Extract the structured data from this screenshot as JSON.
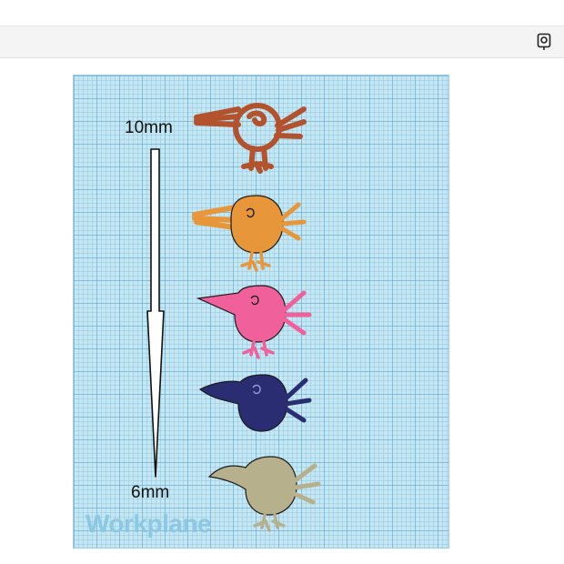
{
  "workplane": {
    "label": "Workplane"
  },
  "measure": {
    "top_label": "10mm",
    "bottom_label": "6mm"
  },
  "toolbar": {
    "icon": "snap-marker-icon"
  },
  "birds": [
    {
      "name": "bird-outline-rust",
      "color": "#b3532e"
    },
    {
      "name": "bird-orange",
      "color": "#e8963a"
    },
    {
      "name": "bird-pink",
      "color": "#f0609a"
    },
    {
      "name": "bird-navy",
      "color": "#2b2d73"
    },
    {
      "name": "bird-khaki",
      "color": "#b7b08c"
    }
  ]
}
